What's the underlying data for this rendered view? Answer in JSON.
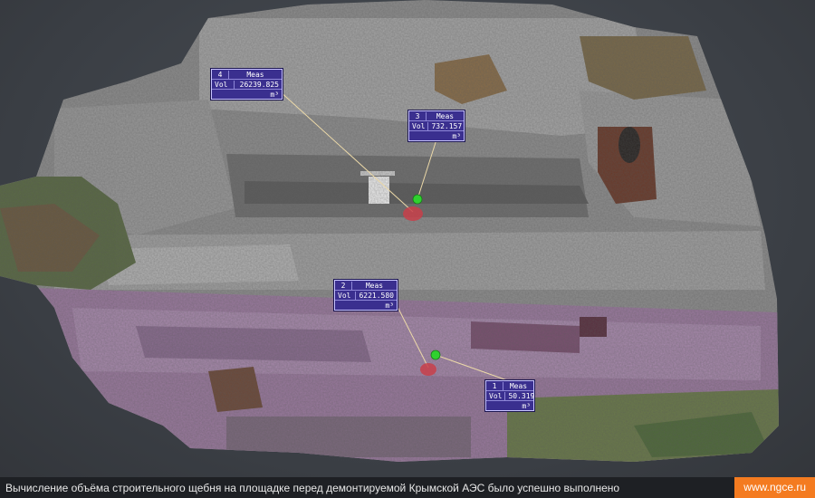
{
  "measurements": [
    {
      "index": "4",
      "name": "Meas",
      "label": "Vol",
      "value": "26239.825",
      "unit": "m³"
    },
    {
      "index": "3",
      "name": "Meas",
      "label": "Vol",
      "value": "732.157",
      "unit": "m³"
    },
    {
      "index": "2",
      "name": "Meas",
      "label": "Vol",
      "value": "6221.580",
      "unit": "m³"
    },
    {
      "index": "1",
      "name": "Meas",
      "label": "Vol",
      "value": "50.319",
      "unit": "m³"
    }
  ],
  "caption": {
    "text": "Вычисление объёма строительного щебня на площадке перед демонтируемой Крымской АЭС было успешно выполнено",
    "link": "www.ngce.ru"
  },
  "colors": {
    "accent": "#f47b20",
    "tag_bg": "#3a2f8f",
    "marker_green": "#2fd12f",
    "marker_red": "#c8404a",
    "highlight": "#b07cc8"
  }
}
